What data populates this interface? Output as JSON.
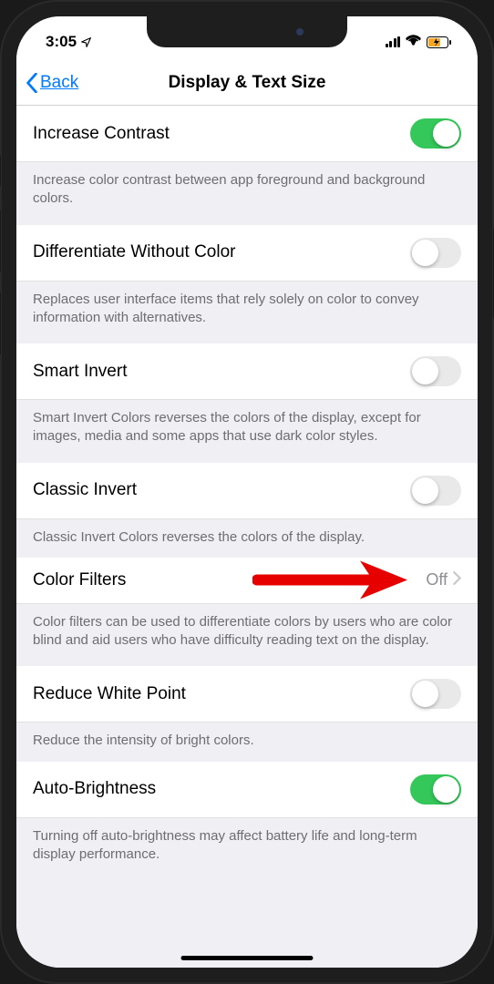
{
  "statusBar": {
    "time": "3:05"
  },
  "nav": {
    "back": "Back",
    "title": "Display & Text Size"
  },
  "rows": {
    "increaseContrast": {
      "label": "Increase Contrast",
      "footer": "Increase color contrast between app foreground and background colors.",
      "on": true
    },
    "differentiate": {
      "label": "Differentiate Without Color",
      "footer": "Replaces user interface items that rely solely on color to convey information with alternatives.",
      "on": false
    },
    "smartInvert": {
      "label": "Smart Invert",
      "footer": "Smart Invert Colors reverses the colors of the display, except for images, media and some apps that use dark color styles.",
      "on": false
    },
    "classicInvert": {
      "label": "Classic Invert",
      "footer": "Classic Invert Colors reverses the colors of the display.",
      "on": false
    },
    "colorFilters": {
      "label": "Color Filters",
      "value": "Off",
      "footer": "Color filters can be used to differentiate colors by users who are color blind and aid users who have difficulty reading text on the display."
    },
    "reduceWhitePoint": {
      "label": "Reduce White Point",
      "footer": "Reduce the intensity of bright colors.",
      "on": false
    },
    "autoBrightness": {
      "label": "Auto-Brightness",
      "footer": "Turning off auto-brightness may affect battery life and long-term display performance.",
      "on": true
    }
  }
}
